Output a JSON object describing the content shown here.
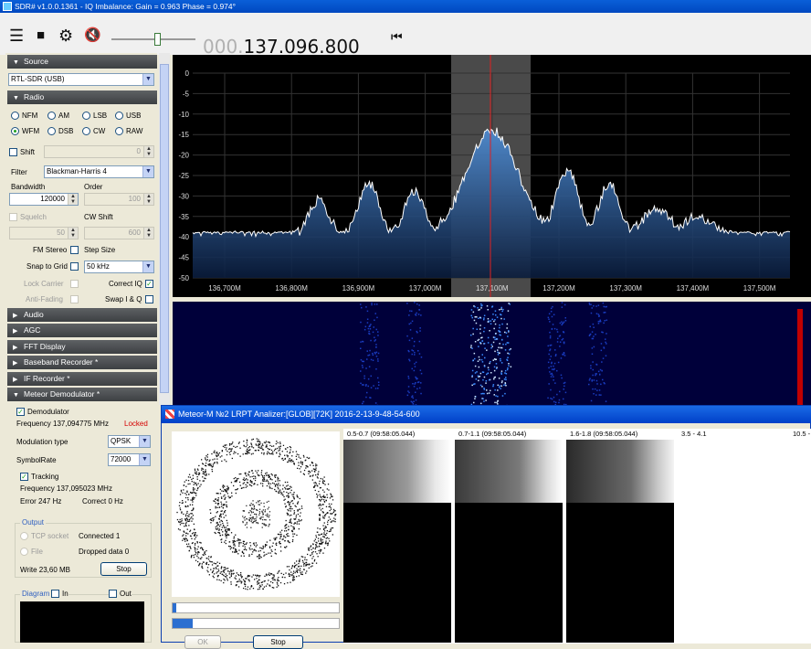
{
  "window_title": "SDR# v1.0.0.1361 - IQ Imbalance: Gain = 0.963 Phase = 0.974°",
  "toolbar": {
    "frequency_dim": "000.",
    "frequency_main": "137.096.800",
    "volume_level": 0.55
  },
  "source": {
    "header": "Source",
    "device": "RTL-SDR (USB)"
  },
  "radio": {
    "header": "Radio",
    "modes": [
      "NFM",
      "AM",
      "LSB",
      "USB",
      "WFM",
      "DSB",
      "CW",
      "RAW"
    ],
    "selected_mode": "WFM",
    "shift_label": "Shift",
    "shift_value": "0",
    "filter_label": "Filter",
    "filter_value": "Blackman-Harris 4",
    "bandwidth_label": "Bandwidth",
    "bandwidth_value": "120000",
    "order_label": "Order",
    "order_value": "100",
    "squelch_label": "Squelch",
    "squelch_value": "50",
    "cw_shift_label": "CW Shift",
    "cw_shift_value": "600",
    "fm_stereo_label": "FM Stereo",
    "step_size_label": "Step Size",
    "snap_label": "Snap to Grid",
    "snap_value": "50 kHz",
    "lock_carrier_label": "Lock Carrier",
    "correct_iq_label": "Correct IQ",
    "anti_fading_label": "Anti-Fading",
    "swap_iq_label": "Swap I & Q"
  },
  "collapsed_sections": [
    "Audio",
    "AGC",
    "FFT Display",
    "Baseband Recorder *",
    "IF Recorder *"
  ],
  "meteor_demod": {
    "header": "Meteor Demodulator *",
    "demodulator_label": "Demodulator",
    "frequency_text": "Frequency 137,094775 MHz",
    "locked_text": "Locked",
    "modulation_label": "Modulation type",
    "modulation_value": "QPSK",
    "symbolrate_label": "SymbolRate",
    "symbolrate_value": "72000",
    "tracking_label": "Tracking",
    "tracking_freq": "Frequency 137,095023 MHz",
    "error_text": "Error 247 Hz",
    "correct_text": "Correct 0 Hz",
    "output_label": "Output",
    "tcp_label": "TCP socket",
    "connected_text": "Connected 1",
    "file_label": "File",
    "dropped_text": "Dropped data 0",
    "write_text": "Write 23,60 MB",
    "stop_label": "Stop",
    "diagram_label": "Diagram",
    "in_label": "In",
    "out_label": "Out"
  },
  "spectrum": {
    "y_ticks": [
      "0",
      "-5",
      "-10",
      "-15",
      "-20",
      "-25",
      "-30",
      "-35",
      "-40",
      "-45",
      "-50"
    ],
    "x_ticks": [
      "136,700M",
      "136,800M",
      "136,900M",
      "137,000M",
      "137,100M",
      "137,200M",
      "137,300M",
      "137,400M",
      "137,500M"
    ]
  },
  "meteor_window": {
    "title": "Meteor-M №2 LRPT Analizer:[GLOB][72K] 2016-2-13-9-48-54-600",
    "channels": [
      "0.5-0.7 (09:58:05.044)",
      "0.7-1.1 (09:58:05.044)",
      "1.6-1.8 (09:58:05.044)",
      "3.5 - 4.1",
      "10.5 -"
    ],
    "progress_1": 0.02,
    "progress_2": 0.12,
    "button_1": "OK",
    "button_2": "Stop"
  },
  "colors": {
    "accent": "#0a5fd8",
    "spectrum_fill": "#2f6fb5",
    "section_header": "#4a4d50",
    "locked": "#d40000"
  }
}
